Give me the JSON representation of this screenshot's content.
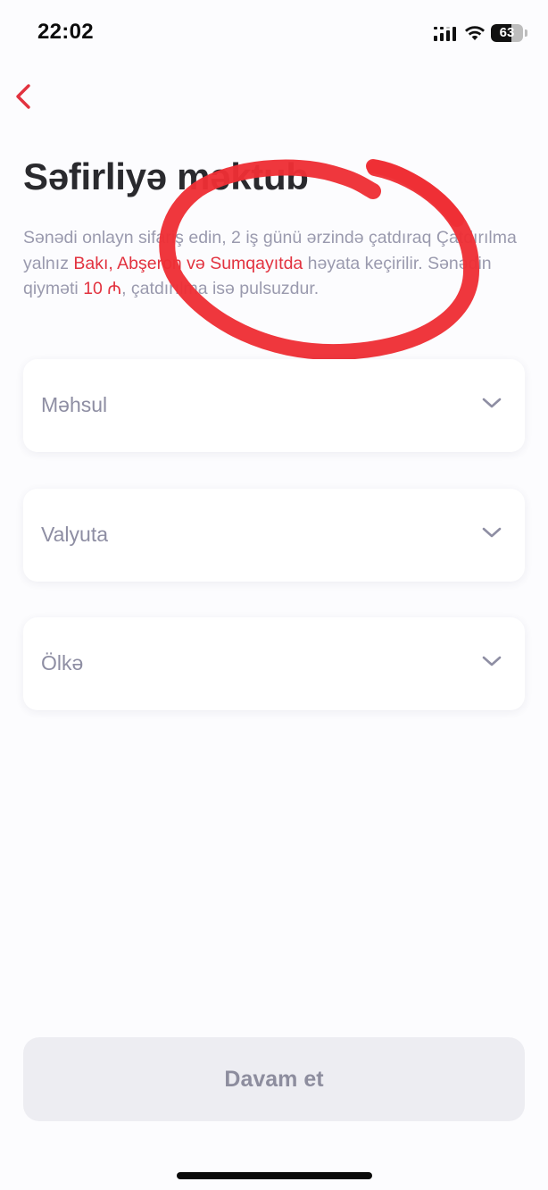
{
  "status_bar": {
    "time": "22:02",
    "battery_percent": 63,
    "battery_label": "63",
    "icons": [
      "cellular-signal-icon",
      "wifi-icon",
      "battery-icon"
    ]
  },
  "header": {
    "back_icon": "chevron-left-icon",
    "title": "Səfirliyə məktub"
  },
  "description": {
    "part1": "Sənədi onlayn sifariş edin, 2 iş günü ərzində çatdıraq Çatdırılma yalnız ",
    "highlight_regions": "Bakı, Abşeron və Sumqayıtda",
    "part2": " həyata keçirilir. Sənədin qiyməti ",
    "highlight_price": "10 ₼",
    "part3": ", çatdırılma isə pulsuzdur."
  },
  "form": {
    "fields": [
      {
        "placeholder": "Məhsul"
      },
      {
        "placeholder": "Valyuta"
      },
      {
        "placeholder": "Ölkə"
      }
    ]
  },
  "footer": {
    "continue_label": "Davam et"
  },
  "colors": {
    "accent": "#E2323F",
    "annotation": "#EE2F35",
    "text_primary": "#2A2A2E",
    "text_muted": "#9A9AAE",
    "button_disabled_bg": "#EDEDF2"
  }
}
